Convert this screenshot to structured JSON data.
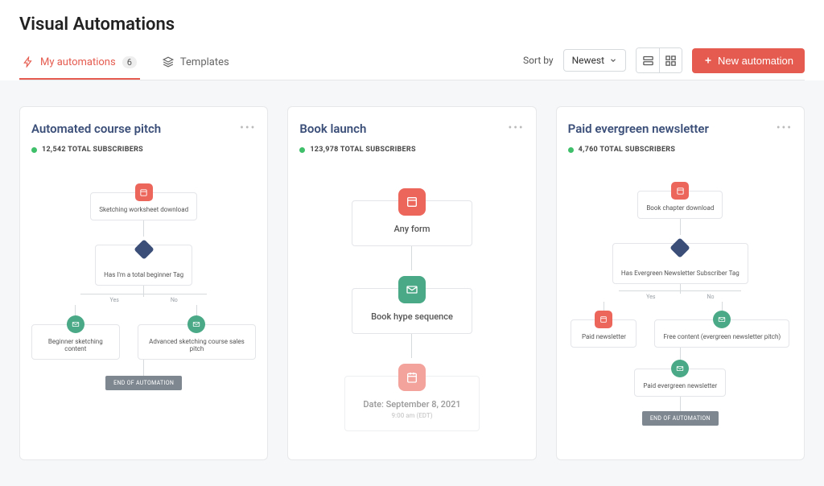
{
  "page_title": "Visual Automations",
  "tabs": {
    "my_automations": "My automations",
    "my_automations_count": "6",
    "templates": "Templates"
  },
  "toolbar": {
    "sort_label": "Sort by",
    "sort_value": "Newest",
    "new_button": "New automation"
  },
  "cards": [
    {
      "title": "Automated course pitch",
      "subscribers": "12,542 TOTAL SUBSCRIBERS",
      "flow": {
        "entry": "Sketching worksheet download",
        "condition": "Has I'm a total beginner Tag",
        "yes_label": "Yes",
        "no_label": "No",
        "branch_left": "Beginner sketching content",
        "branch_right": "Advanced sketching course sales pitch",
        "end": "END OF AUTOMATION"
      }
    },
    {
      "title": "Book launch",
      "subscribers": "123,978 TOTAL SUBSCRIBERS",
      "flow": {
        "entry": "Any form",
        "sequence": "Book hype sequence",
        "date_line1": "Date: September 8, 2021",
        "date_line2": "9:00 am (EDT)"
      }
    },
    {
      "title": "Paid evergreen newsletter",
      "subscribers": "4,760 TOTAL SUBSCRIBERS",
      "flow": {
        "entry": "Book chapter download",
        "condition": "Has Evergreen Newsletter Subscriber Tag",
        "yes_label": "Yes",
        "no_label": "No",
        "branch_left": "Paid newsletter",
        "branch_right": "Free content (evergreen newsletter pitch)",
        "merge": "Paid evergreen newsletter",
        "end": "END OF AUTOMATION"
      }
    }
  ]
}
